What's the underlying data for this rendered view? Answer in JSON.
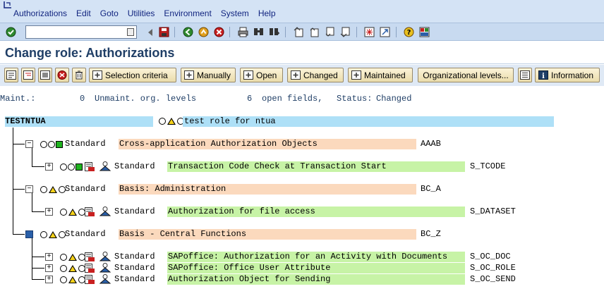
{
  "menu": [
    "Authorizations",
    "Edit",
    "Goto",
    "Utilities",
    "Environment",
    "System",
    "Help"
  ],
  "command_field": {
    "value": ""
  },
  "title": "Change role: Authorizations",
  "app_toolbar": {
    "selection_criteria": "Selection criteria",
    "manually": "Manually",
    "open": "Open",
    "changed": "Changed",
    "maintained": "Maintained",
    "org_levels": "Organizational levels...",
    "information": "Information"
  },
  "status": {
    "maint_label": "Maint.:",
    "maint_count": "0",
    "unmaint_label": "Unmaint. org. levels",
    "open_count": "6",
    "open_label": "open fields,",
    "status_label": "Status:",
    "status_value": "Changed"
  },
  "colors": {
    "root_highlight": "#aee0f7",
    "class_highlight": "#fbd9bd",
    "object_highlight": "#c7f3a6",
    "green_light": "#1fb31f",
    "yellow_light": "#f6d21a"
  },
  "tree": {
    "root": {
      "name": "TESTNTUA",
      "description": "test role for ntua"
    },
    "classes": [
      {
        "status": "Standard",
        "text": "Cross-application Authorization Objects",
        "code": "AAAB",
        "light": "green",
        "objects": [
          {
            "status": "Standard",
            "text": "Transaction Code Check at Transaction Start",
            "code": "S_TCODE",
            "light": "green"
          }
        ]
      },
      {
        "status": "Standard",
        "text": "Basis: Administration",
        "code": "BC_A",
        "light": "yellow",
        "objects": [
          {
            "status": "Standard",
            "text": "Authorization for file access",
            "code": "S_DATASET",
            "light": "yellow"
          }
        ]
      },
      {
        "status": "Standard",
        "text": "Basis - Central Functions",
        "code": "BC_Z",
        "light": "yellow",
        "objects": [
          {
            "status": "Standard",
            "text": "SAPoffice: Authorization for an Activity with Documents",
            "code": "S_OC_DOC",
            "light": "yellow"
          },
          {
            "status": "Standard",
            "text": "SAPoffice: Office User Attribute",
            "code": "S_OC_ROLE",
            "light": "yellow"
          },
          {
            "status": "Standard",
            "text": "Authorization Object for Sending",
            "code": "S_OC_SEND",
            "light": "yellow"
          }
        ]
      }
    ]
  }
}
